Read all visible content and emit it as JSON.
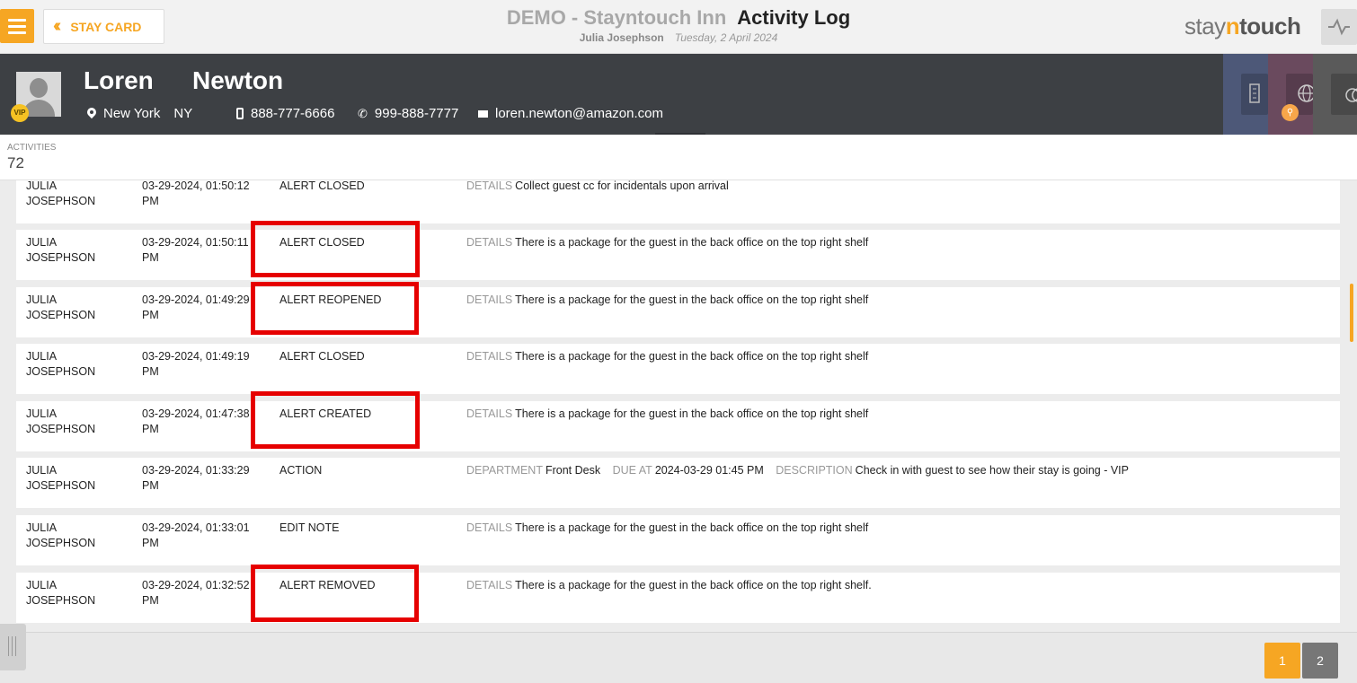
{
  "header": {
    "stay_card_label": "STAY CARD",
    "hotel_name": "DEMO - Stayntouch Inn",
    "page_title": "Activity Log",
    "user_name": "Julia Josephson",
    "date": "Tuesday, 2 April 2024",
    "logo": {
      "part1": "stay",
      "part2": "n",
      "part3": "touch"
    }
  },
  "guest": {
    "first_name": "Loren",
    "last_name": "Newton",
    "vip_badge": "VIP",
    "city": "New York",
    "state": "NY",
    "mobile": "888-777-6666",
    "phone": "999-888-7777",
    "email": "loren.newton@amazon.com"
  },
  "summary": {
    "label": "ACTIVITIES",
    "count": "72"
  },
  "activities": [
    {
      "user1": "JULIA",
      "user2": "JOSEPHSON",
      "date1": "03-29-2024, 01:50:12",
      "date2": "PM",
      "action": "ALERT CLOSED",
      "details": [
        {
          "key": "DETAILS",
          "value": "Collect guest cc for incidentals upon arrival"
        }
      ]
    },
    {
      "user1": "JULIA",
      "user2": "JOSEPHSON",
      "date1": "03-29-2024, 01:50:11",
      "date2": "PM",
      "action": "ALERT CLOSED",
      "details": [
        {
          "key": "DETAILS",
          "value": "There is a package for the guest in the back office on the top right shelf"
        }
      ]
    },
    {
      "user1": "JULIA",
      "user2": "JOSEPHSON",
      "date1": "03-29-2024, 01:49:29",
      "date2": "PM",
      "action": "ALERT REOPENED",
      "details": [
        {
          "key": "DETAILS",
          "value": "There is a package for the guest in the back office on the top right shelf"
        }
      ]
    },
    {
      "user1": "JULIA",
      "user2": "JOSEPHSON",
      "date1": "03-29-2024, 01:49:19",
      "date2": "PM",
      "action": "ALERT CLOSED",
      "details": [
        {
          "key": "DETAILS",
          "value": "There is a package for the guest in the back office on the top right shelf"
        }
      ]
    },
    {
      "user1": "JULIA",
      "user2": "JOSEPHSON",
      "date1": "03-29-2024, 01:47:38",
      "date2": "PM",
      "action": "ALERT CREATED",
      "details": [
        {
          "key": "DETAILS",
          "value": "There is a package for the guest in the back office on the top right shelf"
        }
      ]
    },
    {
      "user1": "JULIA",
      "user2": "JOSEPHSON",
      "date1": "03-29-2024, 01:33:29",
      "date2": "PM",
      "action": "ACTION",
      "details": [
        {
          "key": "DEPARTMENT",
          "value": "Front Desk"
        },
        {
          "key": "DUE AT",
          "value": "2024-03-29 01:45 PM"
        },
        {
          "key": "DESCRIPTION",
          "value": "Check in with guest to see how their stay is going - VIP"
        }
      ]
    },
    {
      "user1": "JULIA",
      "user2": "JOSEPHSON",
      "date1": "03-29-2024, 01:33:01",
      "date2": "PM",
      "action": "EDIT NOTE",
      "details": [
        {
          "key": "DETAILS",
          "value": "There is a package for the guest in the back office on the top right shelf"
        }
      ]
    },
    {
      "user1": "JULIA",
      "user2": "JOSEPHSON",
      "date1": "03-29-2024, 01:32:52",
      "date2": "PM",
      "action": "ALERT REMOVED",
      "details": [
        {
          "key": "DETAILS",
          "value": "There is a package for the guest in the back office on the top right shelf."
        }
      ]
    }
  ],
  "pagination": {
    "pages": [
      "1",
      "2"
    ],
    "current": "1"
  },
  "colors": {
    "accent": "#f6a623",
    "header_dark": "#3d4044",
    "highlight": "#e60000"
  },
  "icons": [
    "menu-icon",
    "double-chevron-left-icon",
    "activity-pulse-icon",
    "location-pin-icon",
    "mobile-phone-icon",
    "phone-icon",
    "email-icon",
    "building-icon",
    "globe-icon",
    "rings-icon",
    "search-icon"
  ]
}
